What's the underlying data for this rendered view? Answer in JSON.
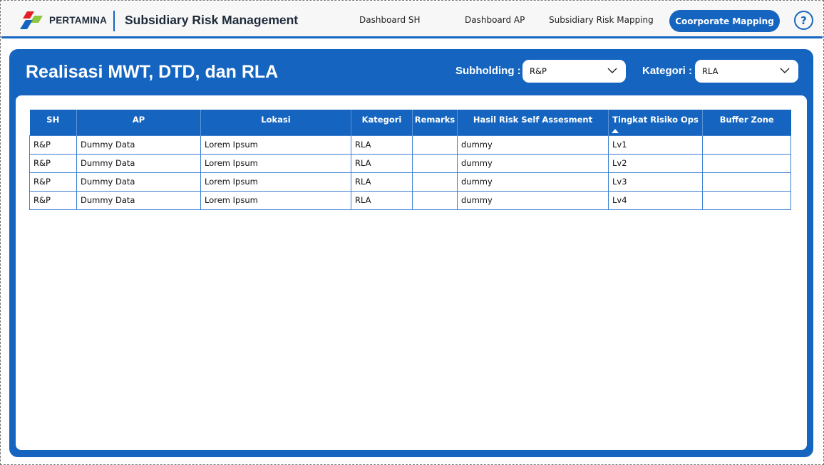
{
  "header": {
    "brand": "PERTAMINA",
    "app_title": "Subsidiary Risk Management",
    "nav": [
      "Dashboard SH",
      "Dashboard AP",
      "Subsidiary Risk Mapping"
    ],
    "cta_label": "Coorporate Mapping",
    "help_label": "?"
  },
  "colors": {
    "primary": "#1565c0",
    "logo_red": "#e31e24",
    "logo_green": "#8dc63f",
    "logo_blue": "#1565c0"
  },
  "icons": {
    "logo": "pertamina-logo-icon",
    "help": "help-icon",
    "dropdown": "chevron-down-icon",
    "sort": "sort-ascending-icon"
  },
  "page": {
    "title": "Realisasi MWT, DTD, dan RLA",
    "filters": {
      "subholding_label": "Subholding :",
      "subholding_value": "R&P",
      "kategori_label": "Kategori :",
      "kategori_value": "RLA"
    }
  },
  "table": {
    "columns": [
      "SH",
      "AP",
      "Lokasi",
      "Kategori",
      "Remarks",
      "Hasil Risk Self Assesment",
      "Tingkat Risiko Ops",
      "Buffer Zone"
    ],
    "sorted_column": "Tingkat Risiko Ops",
    "rows": [
      [
        "R&P",
        "Dummy Data",
        "Lorem Ipsum",
        "RLA",
        "",
        "dummy",
        "Lv1",
        ""
      ],
      [
        "R&P",
        "Dummy Data",
        "Lorem Ipsum",
        "RLA",
        "",
        "dummy",
        "Lv2",
        ""
      ],
      [
        "R&P",
        "Dummy Data",
        "Lorem Ipsum",
        "RLA",
        "",
        "dummy",
        "Lv3",
        ""
      ],
      [
        "R&P",
        "Dummy Data",
        "Lorem Ipsum",
        "RLA",
        "",
        "dummy",
        "Lv4",
        ""
      ]
    ]
  }
}
